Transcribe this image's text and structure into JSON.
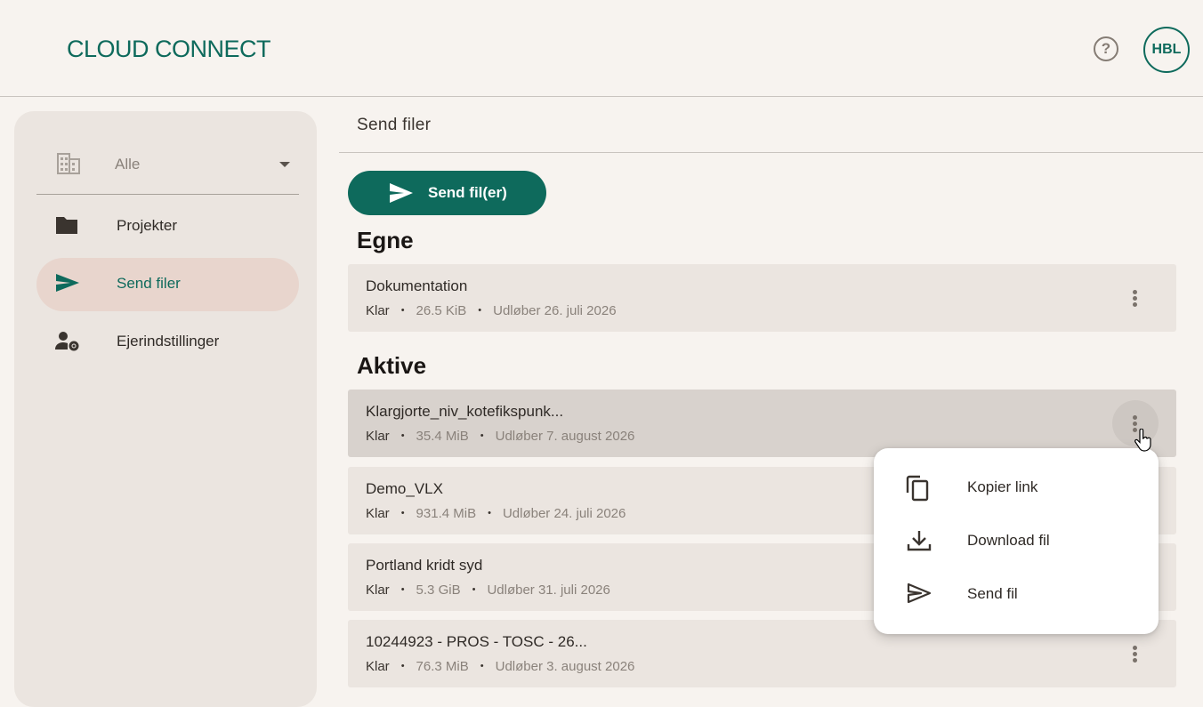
{
  "header": {
    "logo": "CLOUD CONNECT",
    "help_symbol": "?",
    "avatar_initials": "HBL"
  },
  "sidebar": {
    "org_select": {
      "value": "Alle",
      "icon": "building-icon"
    },
    "items": [
      {
        "label": "Projekter",
        "icon": "folder-icon",
        "active": false
      },
      {
        "label": "Send filer",
        "icon": "send-icon",
        "active": true
      },
      {
        "label": "Ejerindstillinger",
        "icon": "user-settings-icon",
        "active": false
      }
    ]
  },
  "main": {
    "section_title": "Send filer",
    "send_button": "Send fil(er)",
    "own_heading": "Egne",
    "active_heading": "Aktive",
    "own_files": [
      {
        "name": "Dokumentation",
        "status": "Klar",
        "size": "26.5 KiB",
        "expires": "Udløber 26. juli 2026"
      }
    ],
    "active_files": [
      {
        "name": "Klargjorte_niv_kotefikspunk...",
        "status": "Klar",
        "size": "35.4 MiB",
        "expires": "Udløber 7. august 2026"
      },
      {
        "name": "Demo_VLX",
        "status": "Klar",
        "size": "931.4 MiB",
        "expires": "Udløber 24. juli 2026"
      },
      {
        "name": "Portland kridt syd",
        "status": "Klar",
        "size": "5.3 GiB",
        "expires": "Udløber 31. juli 2026"
      },
      {
        "name": "10244923 - PROS - TOSC - 26...",
        "status": "Klar",
        "size": "76.3 MiB",
        "expires": "Udløber 3. august 2026"
      }
    ]
  },
  "context_menu": {
    "items": [
      {
        "label": "Kopier link",
        "icon": "copy-icon"
      },
      {
        "label": "Download fil",
        "icon": "download-icon"
      },
      {
        "label": "Send fil",
        "icon": "send-outline-icon"
      }
    ]
  },
  "colors": {
    "brand": "#0e6a5c",
    "background": "#f7f3ef",
    "sidebar": "#ebe5e0",
    "active_nav": "#e8d5cd"
  }
}
